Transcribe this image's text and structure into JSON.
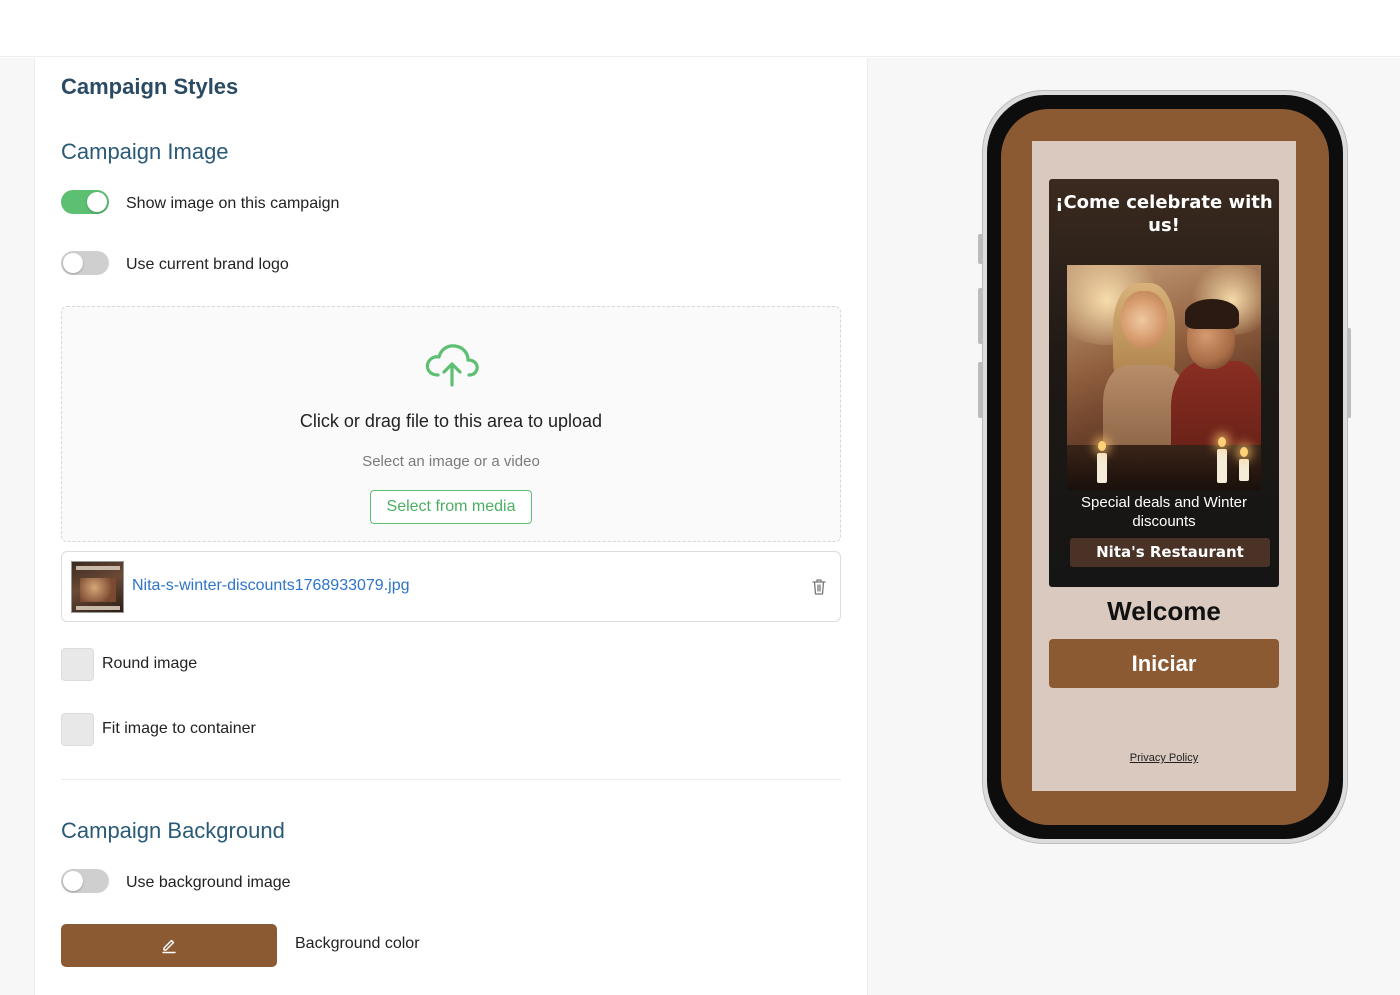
{
  "editor": {
    "heading": "Campaign Styles",
    "image_section": {
      "title": "Campaign Image",
      "toggles": [
        {
          "label": "Show image on this campaign",
          "on": true
        },
        {
          "label": "Use current brand logo",
          "on": false
        }
      ],
      "upload": {
        "title": "Click or drag file to this area to upload",
        "subtitle": "Select an image or a video",
        "button": "Select from media",
        "icon": "cloud-upload-icon"
      },
      "file": {
        "name": "Nita-s-winter-discounts1768933079.jpg",
        "delete_icon": "trash-icon"
      },
      "checkboxes": [
        {
          "label": "Round image",
          "checked": false
        },
        {
          "label": "Fit image to container",
          "checked": false
        }
      ]
    },
    "background_section": {
      "title": "Campaign Background",
      "toggle": {
        "label": "Use background image",
        "on": false
      },
      "color": {
        "label": "Background color",
        "value": "#8b5a33",
        "icon": "pencil-icon"
      }
    }
  },
  "preview": {
    "promo_title": "¡Come celebrate with us!",
    "promo_subtitle": "Special deals and Winter discounts",
    "business_name": "Nita's Restaurant",
    "welcome": "Welcome",
    "start_button": "Iniciar",
    "privacy_link": "Privacy Policy"
  },
  "colors": {
    "accent_green": "#5cbf72",
    "heading_blue": "#2b5a78",
    "link_blue": "#2e74c9",
    "brand_brown": "#8b5a33",
    "card_beige": "#d9c9bf"
  }
}
